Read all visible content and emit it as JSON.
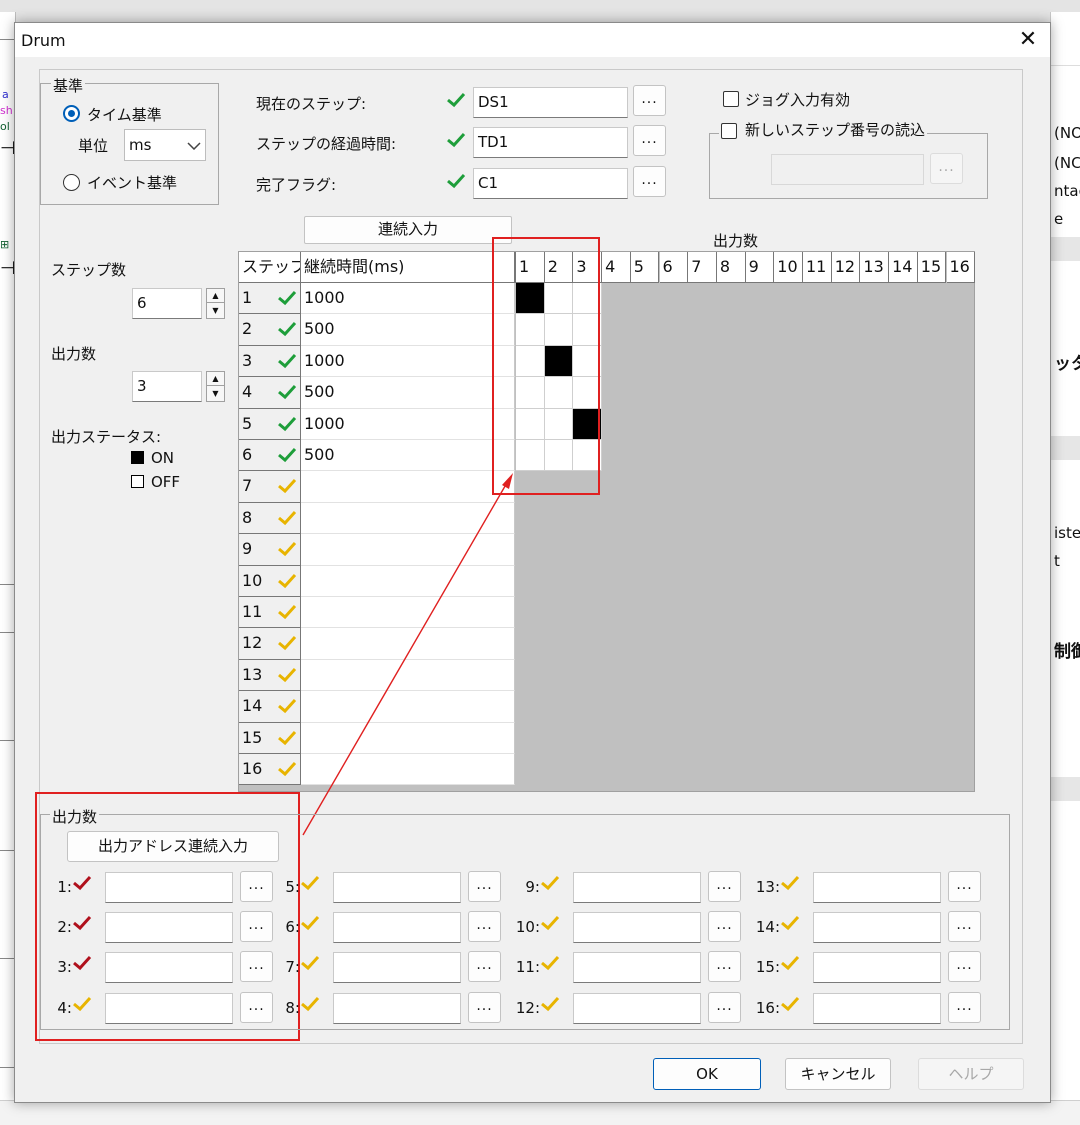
{
  "window": {
    "title": "Drum",
    "close_glyph": "✕"
  },
  "background_app": {
    "left_fragments": [
      "a",
      "sh",
      "ol ",
      "⊣",
      "⊞",
      "⊣"
    ],
    "right_fragments": [
      "(NO",
      "(NC)",
      "ntac",
      "e",
      "ッタ",
      "iste",
      "t",
      "制御"
    ]
  },
  "base": {
    "group_label": "基準",
    "time_base_label": "タイム基準",
    "unit_label": "単位",
    "unit_value": "ms",
    "event_base_label": "イベント基準",
    "selected": "time"
  },
  "addresses": {
    "current_step_label": "現在のステップ:",
    "current_step_value": "DS1",
    "elapsed_label": "ステップの経過時間:",
    "elapsed_value": "TD1",
    "done_flag_label": "完了フラグ:",
    "done_flag_value": "C1",
    "browse_glyph": "..."
  },
  "jog": {
    "jog_enable_label": "ジョグ入力有効",
    "new_step_label": "新しいステップ番号の読込",
    "new_step_value": ""
  },
  "continuous_input_label": "連続入力",
  "steps_label": "ステップ数",
  "steps_value": "6",
  "outputs_label": "出力数",
  "outputs_value": "3",
  "output_status_label": "出力ステータス:",
  "legend_on": "ON",
  "legend_off": "OFF",
  "grid": {
    "step_header": "ステップ",
    "duration_header": "継続時間(ms)",
    "outputs_header": "出力数",
    "columns": [
      "1",
      "2",
      "3",
      "4",
      "5",
      "6",
      "7",
      "8",
      "9",
      "10",
      "11",
      "12",
      "13",
      "14",
      "15",
      "16"
    ],
    "rows": [
      {
        "step": "1",
        "status": "done",
        "duration": "1000",
        "outputs": [
          1,
          0,
          0
        ]
      },
      {
        "step": "2",
        "status": "done",
        "duration": "500",
        "outputs": [
          0,
          0,
          0
        ]
      },
      {
        "step": "3",
        "status": "done",
        "duration": "1000",
        "outputs": [
          0,
          1,
          0
        ]
      },
      {
        "step": "4",
        "status": "done",
        "duration": "500",
        "outputs": [
          0,
          0,
          0
        ]
      },
      {
        "step": "5",
        "status": "done",
        "duration": "1000",
        "outputs": [
          0,
          0,
          1
        ]
      },
      {
        "step": "6",
        "status": "done",
        "duration": "500",
        "outputs": [
          0,
          0,
          0
        ]
      },
      {
        "step": "7",
        "status": "pending",
        "duration": "",
        "outputs": []
      },
      {
        "step": "8",
        "status": "pending",
        "duration": "",
        "outputs": []
      },
      {
        "step": "9",
        "status": "pending",
        "duration": "",
        "outputs": []
      },
      {
        "step": "10",
        "status": "pending",
        "duration": "",
        "outputs": []
      },
      {
        "step": "11",
        "status": "pending",
        "duration": "",
        "outputs": []
      },
      {
        "step": "12",
        "status": "pending",
        "duration": "",
        "outputs": []
      },
      {
        "step": "13",
        "status": "pending",
        "duration": "",
        "outputs": []
      },
      {
        "step": "14",
        "status": "pending",
        "duration": "",
        "outputs": []
      },
      {
        "step": "15",
        "status": "pending",
        "duration": "",
        "outputs": []
      },
      {
        "step": "16",
        "status": "pending",
        "duration": "",
        "outputs": []
      }
    ]
  },
  "output_addresses": {
    "group_label": "出力数",
    "continuous_button_label": "出力アドレス連続入力",
    "items": [
      {
        "label": "1:",
        "status": "error",
        "value": ""
      },
      {
        "label": "2:",
        "status": "error",
        "value": ""
      },
      {
        "label": "3:",
        "status": "error",
        "value": ""
      },
      {
        "label": "4:",
        "status": "pending",
        "value": ""
      },
      {
        "label": "5:",
        "status": "pending",
        "value": ""
      },
      {
        "label": "6:",
        "status": "pending",
        "value": ""
      },
      {
        "label": "7:",
        "status": "pending",
        "value": ""
      },
      {
        "label": "8:",
        "status": "pending",
        "value": ""
      },
      {
        "label": "9:",
        "status": "pending",
        "value": ""
      },
      {
        "label": "10:",
        "status": "pending",
        "value": ""
      },
      {
        "label": "11:",
        "status": "pending",
        "value": ""
      },
      {
        "label": "12:",
        "status": "pending",
        "value": ""
      },
      {
        "label": "13:",
        "status": "pending",
        "value": ""
      },
      {
        "label": "14:",
        "status": "pending",
        "value": ""
      },
      {
        "label": "15:",
        "status": "pending",
        "value": ""
      },
      {
        "label": "16:",
        "status": "pending",
        "value": ""
      }
    ]
  },
  "buttons": {
    "ok": "OK",
    "cancel": "キャンセル",
    "help": "ヘルプ"
  },
  "colors": {
    "check_done": "#1e9e3a",
    "check_pending": "#e8b400",
    "check_error": "#b0101c",
    "annotation": "#e02020",
    "accent": "#005fb8"
  }
}
